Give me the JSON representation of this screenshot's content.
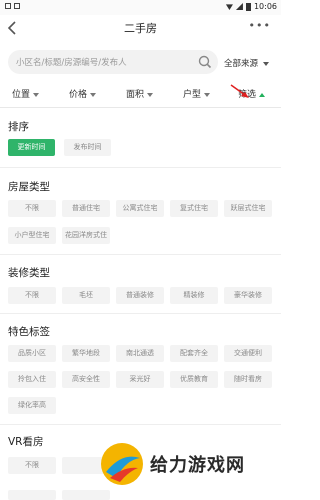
{
  "statusbar": {
    "time": "10:06"
  },
  "header": {
    "title": "二手房",
    "back_icon": "chevron-left-icon",
    "more_label": "•••"
  },
  "search": {
    "placeholder": "小区名/标题/房源编号/发布人",
    "source_label": "全部来源"
  },
  "filters": {
    "location": "位置",
    "price": "价格",
    "area": "面积",
    "layout": "户型",
    "screen": "筛选"
  },
  "sections": {
    "sort": {
      "title": "排序",
      "options": [
        "更新时间",
        "发布时间"
      ]
    },
    "house_type": {
      "title": "房屋类型",
      "options": [
        "不限",
        "普通住宅",
        "公寓式住宅",
        "复式住宅",
        "跃层式住宅",
        "小户型住宅",
        "花园洋房式住"
      ]
    },
    "decoration": {
      "title": "装修类型",
      "options": [
        "不限",
        "毛坯",
        "普通装修",
        "精装修",
        "豪华装修"
      ]
    },
    "features": {
      "title": "特色标签",
      "options": [
        "品质小区",
        "繁华地段",
        "南北通透",
        "配套齐全",
        "交通便利",
        "拎包入住",
        "高安全性",
        "采光好",
        "优质教育",
        "随时看房",
        "绿化率高"
      ]
    },
    "vr": {
      "title": "VR看房",
      "options": [
        "不限"
      ]
    }
  },
  "watermark": {
    "text": "给力游戏网"
  },
  "colors": {
    "accent": "#2fb46a",
    "arrow": "#e02020",
    "logo": "#f4b400"
  }
}
